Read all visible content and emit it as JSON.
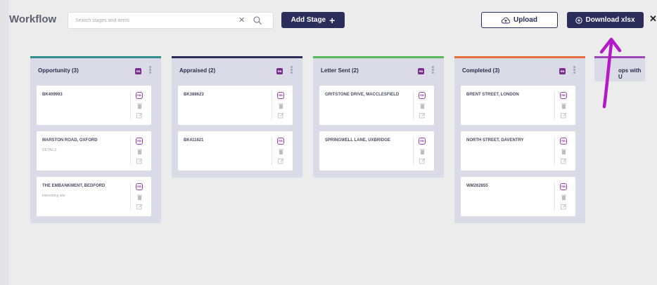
{
  "app": {
    "title": "Workflow"
  },
  "search": {
    "placeholder": "Search stages and items"
  },
  "toolbar": {
    "add_stage_label": "Add Stage",
    "upload_label": "Upload",
    "download_label": "Download xlsx"
  },
  "colors": {
    "navy": "#2b2d5a",
    "opportunity": "#2f8f8f",
    "appraised": "#2b2d5a",
    "letter_sent": "#58b85c",
    "completed": "#e6703d",
    "partial": "#9a48b8",
    "badge": "#7a2d8c",
    "annotation": "#b418c9"
  },
  "columns": [
    {
      "title": "Opportunity (3)",
      "badge": "RB",
      "cards": [
        {
          "title": "BK409993",
          "sub": "",
          "rb": "RB"
        },
        {
          "title": "MARSTON ROAD, OXFORD",
          "sub": "DETAILS",
          "rb": "RB"
        },
        {
          "title": "THE EMBANKMENT, BEDFORD",
          "sub": "Interesting site",
          "rb": "RB"
        }
      ]
    },
    {
      "title": "Appraised (2)",
      "badge": "RB",
      "cards": [
        {
          "title": "BK388623",
          "sub": "",
          "rb": "RB"
        },
        {
          "title": "BK411621",
          "sub": "",
          "rb": "RB"
        }
      ]
    },
    {
      "title": "Letter Sent (2)",
      "badge": "RB",
      "cards": [
        {
          "title": "GRITSTONE DRIVE, MACCLESFIELD",
          "sub": "",
          "rb": "RB"
        },
        {
          "title": "SPRINGWELL LANE, UXBRIDGE",
          "sub": "",
          "rb": "RB"
        }
      ]
    },
    {
      "title": "Completed (3)",
      "badge": "RB",
      "cards": [
        {
          "title": "BRENT STREET, LONDON",
          "sub": "",
          "rb": "RB"
        },
        {
          "title": "NORTH STREET, DAVENTRY",
          "sub": "",
          "rb": "RB"
        },
        {
          "title": "WM262855",
          "sub": "",
          "rb": "RB"
        }
      ]
    },
    {
      "title": "ops with U"
    }
  ]
}
